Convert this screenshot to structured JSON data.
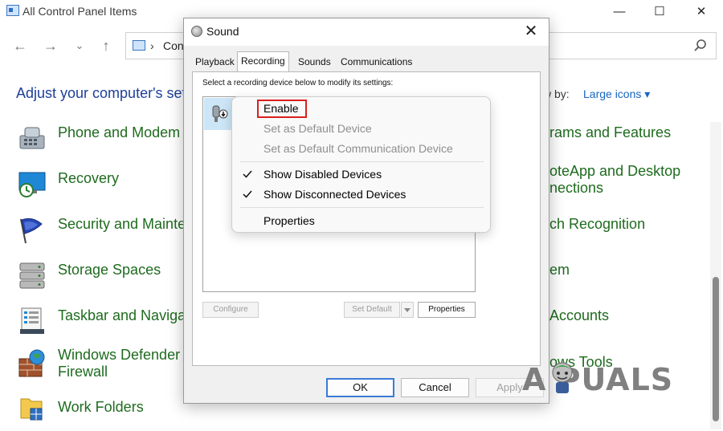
{
  "control_panel": {
    "title": "All Control Panel Items",
    "window_buttons": {
      "minimize": "—",
      "maximize": "☐",
      "close": "✕"
    },
    "nav": {
      "back": "←",
      "forward": "→",
      "recent": "⌄",
      "up": "↑"
    },
    "address": {
      "separator": "›",
      "text": "Contr"
    },
    "heading": "Adjust your computer's set",
    "view_by_label": "w by:",
    "view_by_value": "Large icons ▾",
    "items_left": [
      {
        "label": "Phone and Modem",
        "icon": "phone-modem-icon"
      },
      {
        "label": "Recovery",
        "icon": "recovery-icon"
      },
      {
        "label": "Security and Mainte",
        "icon": "security-flag-icon"
      },
      {
        "label": "Storage Spaces",
        "icon": "storage-spaces-icon"
      },
      {
        "label": "Taskbar and Naviga",
        "icon": "taskbar-icon"
      },
      {
        "label": "Windows Defender\nFirewall",
        "line1": "Windows Defender",
        "line2": "Firewall",
        "icon": "firewall-icon"
      },
      {
        "label": "Work Folders",
        "icon": "work-folders-icon"
      }
    ],
    "items_right": [
      {
        "label": "rams and Features"
      },
      {
        "line1": "oteApp and Desktop",
        "line2": "nections"
      },
      {
        "label": "ch Recognition"
      },
      {
        "label": "em"
      },
      {
        "label": "Accounts"
      },
      {
        "label": "ows Tools"
      }
    ]
  },
  "sound_dialog": {
    "title": "Sound",
    "close": "✕",
    "tabs": [
      "Playback",
      "Recording",
      "Sounds",
      "Communications"
    ],
    "active_tab": "Recording",
    "instruction": "Select a recording device below to modify its settings:",
    "buttons": {
      "configure": "Configure",
      "set_default": "Set Default",
      "properties": "Properties"
    },
    "footer": {
      "ok": "OK",
      "cancel": "Cancel",
      "apply": "Apply"
    }
  },
  "context_menu": {
    "items": [
      {
        "label": "Enable",
        "enabled": true,
        "checked": false,
        "highlighted": true
      },
      {
        "label": "Set as Default Device",
        "enabled": false,
        "checked": false
      },
      {
        "label": "Set as Default Communication Device",
        "enabled": false,
        "checked": false
      },
      {
        "label": "Show Disabled Devices",
        "enabled": true,
        "checked": true
      },
      {
        "label": "Show Disconnected Devices",
        "enabled": true,
        "checked": true
      },
      {
        "label": "Properties",
        "enabled": true,
        "checked": false
      }
    ]
  },
  "watermark": {
    "text": "A  PUALS"
  },
  "colors": {
    "link_blue": "#1e3f9a",
    "item_green": "#1e6b1e",
    "highlight_red": "#d91f1f",
    "selection_blue": "#cde6f7",
    "default_button_border": "#3a7bd5"
  }
}
